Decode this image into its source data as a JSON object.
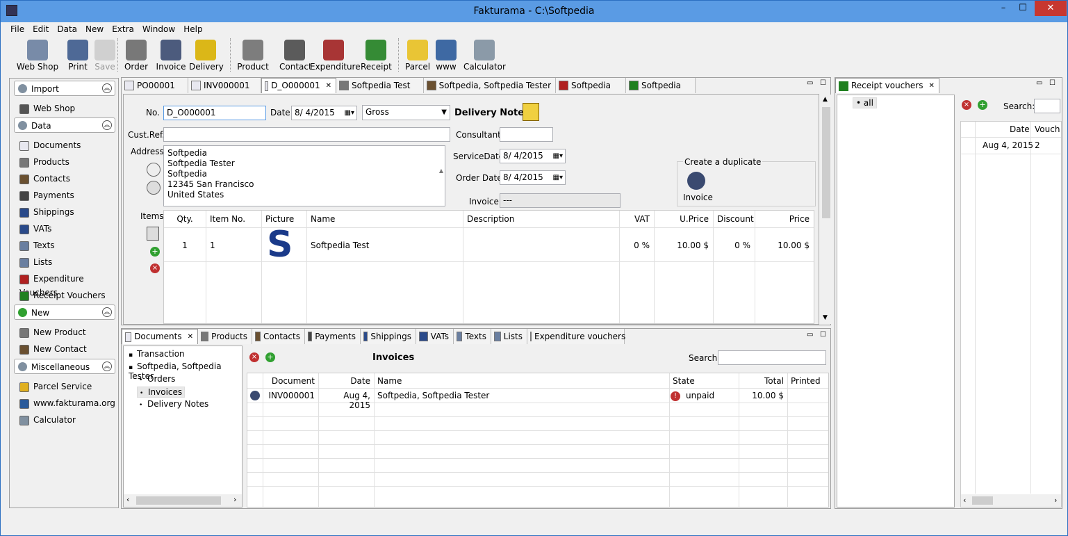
{
  "window": {
    "title": "Fakturama - C:\\Softpedia",
    "min": "–",
    "max": "☐",
    "close": "✕"
  },
  "menu": [
    "File",
    "Edit",
    "Data",
    "New",
    "Extra",
    "Window",
    "Help"
  ],
  "toolbar": [
    {
      "label": "Web Shop",
      "icon": "web-shop-icon",
      "color": "#6a7fa0"
    },
    {
      "label": "Print",
      "icon": "printer-icon",
      "color": "#3c5a8c"
    },
    {
      "label": "Save",
      "icon": "save-icon",
      "color": "#b0b0b0",
      "disabled": true
    },
    {
      "label": "Order",
      "icon": "order-icon",
      "color": "#6a6a6a"
    },
    {
      "label": "Invoice",
      "icon": "invoice-icon",
      "color": "#3a4a70"
    },
    {
      "label": "Delivery",
      "icon": "delivery-icon",
      "color": "#d8b000"
    },
    {
      "label": "Product",
      "icon": "product-icon",
      "color": "#707070"
    },
    {
      "label": "Contact",
      "icon": "contact-icon",
      "color": "#4a4a4a"
    },
    {
      "label": "Expenditure",
      "icon": "expenditure-icon",
      "color": "#a02020"
    },
    {
      "label": "Receipt",
      "icon": "receipt-icon",
      "color": "#208020"
    },
    {
      "label": "Parcel",
      "icon": "parcel-icon",
      "color": "#e8c020"
    },
    {
      "label": "www",
      "icon": "globe-icon",
      "color": "#2a5a9a"
    },
    {
      "label": "Calculator",
      "icon": "calculator-icon",
      "color": "#8090a0"
    }
  ],
  "nav": {
    "sections": [
      {
        "title": "Import",
        "items": [
          "Web Shop"
        ]
      },
      {
        "title": "Data",
        "items": [
          "Documents",
          "Products",
          "Contacts",
          "Payments",
          "Shippings",
          "VATs",
          "Texts",
          "Lists",
          "Expenditure Vouchers",
          "Receipt Vouchers"
        ]
      },
      {
        "title": "New",
        "items": [
          "New Product",
          "New Contact"
        ]
      },
      {
        "title": "Miscellaneous",
        "items": [
          "Parcel Service",
          "www.fakturama.org",
          "Calculator"
        ]
      }
    ]
  },
  "editor_tabs": [
    "PO00001",
    "INV000001",
    "D_O000001",
    "Softpedia Test",
    "Softpedia, Softpedia Tester",
    "Softpedia",
    "Softpedia"
  ],
  "form": {
    "no_label": "No.",
    "no_value": "D_O000001",
    "date_label": "Date",
    "date_value": "8/ 4/2015",
    "gross": "Gross",
    "doc_type": "Delivery Note",
    "custref_label": "Cust.Ref.",
    "consultant_label": "Consultant",
    "address_label": "Address",
    "address_lines": [
      "Softpedia",
      "Softpedia Tester",
      "Softpedia",
      "12345 San Francisco",
      "United States"
    ],
    "service_label": "ServiceDate",
    "service_value": "8/ 4/2015",
    "order_label": "Order Date",
    "order_value": "8/ 4/2015",
    "invoice_label": "Invoice",
    "invoice_value": "---",
    "dup_label": "Create a duplicate",
    "dup_button": "Invoice",
    "items_label": "Items"
  },
  "items_table": {
    "headers": [
      "Qty.",
      "Item No.",
      "Picture",
      "Name",
      "Description",
      "VAT",
      "U.Price",
      "Discount",
      "Price"
    ],
    "rows": [
      {
        "qty": "1",
        "itemno": "1",
        "picture": "S",
        "name": "Softpedia Test",
        "description": "",
        "vat": "0 %",
        "uprice": "10.00 $",
        "discount": "0 %",
        "price": "10.00 $"
      }
    ]
  },
  "bottom_tabs": [
    "Documents",
    "Products",
    "Contacts",
    "Payments",
    "Shippings",
    "VATs",
    "Texts",
    "Lists",
    "Expenditure vouchers"
  ],
  "tree": [
    "Transaction",
    "Softpedia, Softpedia Tester",
    "Orders",
    "Invoices",
    "Delivery Notes"
  ],
  "invoices": {
    "title": "Invoices",
    "search_label": "Search:",
    "headers": [
      "Document",
      "Date",
      "Name",
      "State",
      "Total",
      "Printed"
    ],
    "rows": [
      {
        "document": "INV000001",
        "date": "Aug 4, 2015",
        "name": "Softpedia, Softpedia Tester",
        "state": "unpaid",
        "total": "10.00 $",
        "printed": ""
      }
    ]
  },
  "receipt": {
    "tab": "Receipt vouchers",
    "filter": "all",
    "search_label": "Search:",
    "headers": [
      "Date",
      "Vouch"
    ],
    "rows": [
      {
        "date": "Aug 4, 2015",
        "vouch": "2"
      }
    ]
  },
  "colors": {
    "accent": "#5a9be4",
    "selected_tab": "#ffffff",
    "error": "#c03030",
    "ok": "#30a030"
  }
}
